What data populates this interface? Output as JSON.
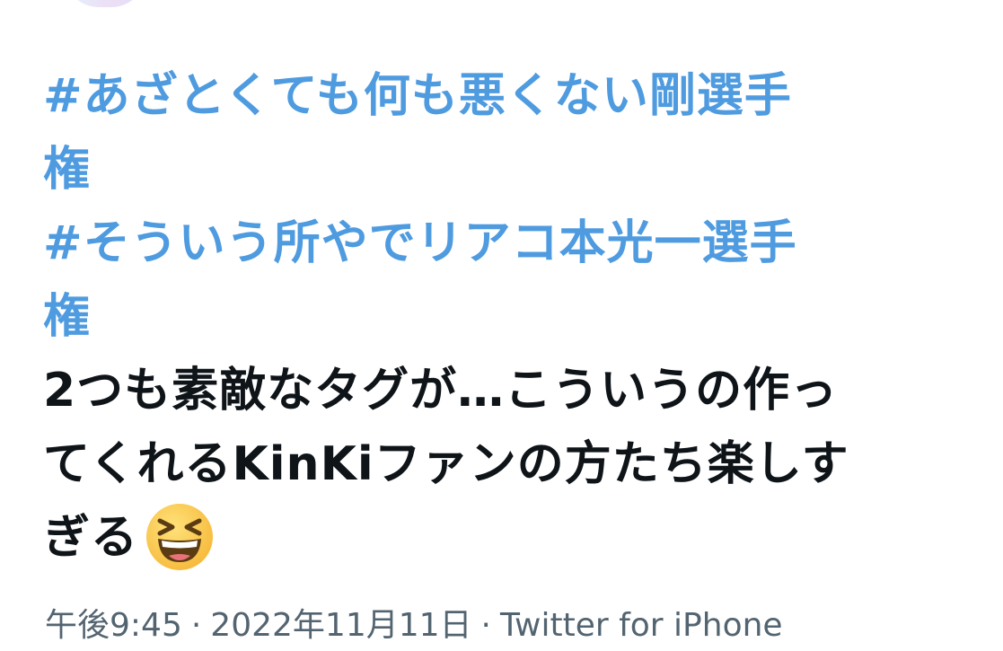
{
  "tweet": {
    "hashtag_lines": [
      "#あざとくても何も悪くない剛選手",
      "権",
      "#そういう所やでリアコ本光一選手",
      "権"
    ],
    "text_lines": [
      "2つも素敵なタグが…こういうの作っ",
      "てくれるKinKiファンの方たち楽しす",
      "ぎる"
    ],
    "emoji": "grinning-squinting-face"
  },
  "meta": {
    "time": "午後9:45",
    "separator": "·",
    "date": "2022年11月11日",
    "source": "Twitter for iPhone"
  },
  "colors": {
    "hashtag": "#4f9be0",
    "text": "#0f1419",
    "meta": "#536471"
  }
}
